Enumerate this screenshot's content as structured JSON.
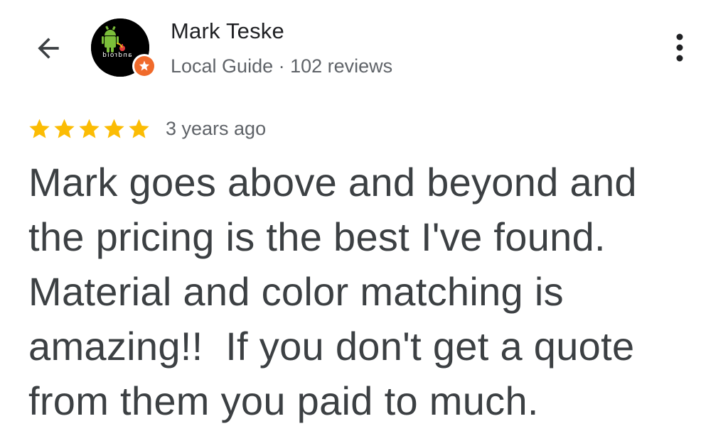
{
  "header": {
    "back_icon": "arrow-back-icon",
    "more_icon": "more-vert-icon"
  },
  "author": {
    "name": "Mark Teske",
    "meta": "Local Guide · 102 reviews",
    "avatar_text": "android",
    "badge_icon": "local-guide-star-icon",
    "badge_color": "#f06a2b"
  },
  "review": {
    "rating": 5,
    "rating_max": 5,
    "star_color": "#fbbc04",
    "timestamp": "3 years ago",
    "text": "Mark goes above and beyond and\nthe pricing is the best I've found.\nMaterial and color matching is\namazing!!  If you don't get a quote\nfrom them you paid to much."
  }
}
